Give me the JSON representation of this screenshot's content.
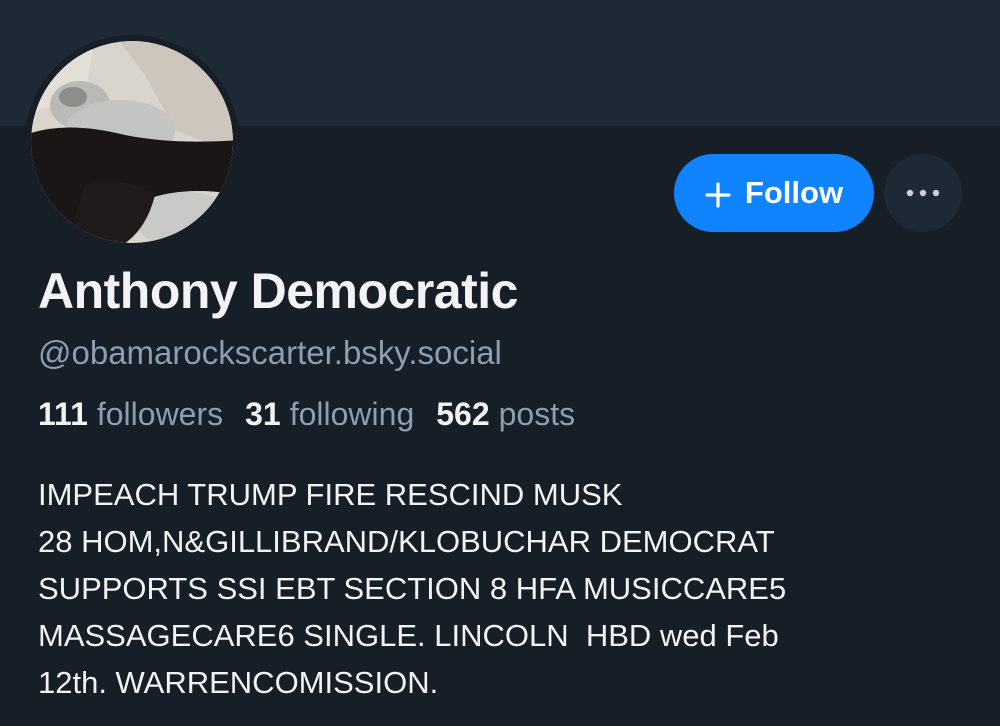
{
  "profile": {
    "display_name": "Anthony Democratic",
    "handle": "@obamarockscarter.bsky.social",
    "follow_label": "Follow",
    "stats": [
      {
        "count": "111",
        "label": "followers"
      },
      {
        "count": "31",
        "label": "following"
      },
      {
        "count": "562",
        "label": "posts"
      }
    ],
    "bio_lines": [
      "IMPEACH TRUMP FIRE RESCIND MUSK",
      "28 HOM,N&GILLIBRAND/KLOBUCHAR DEMOCRAT",
      "SUPPORTS SSI EBT SECTION 8 HFA MUSICCARE5",
      "MASSAGECARE6 SINGLE. LINCOLN  HBD wed Feb",
      "12th. WARRENCOMISSION."
    ]
  },
  "icons": {
    "follow": "plus-icon",
    "more": "more-horizontal-icon"
  },
  "colors": {
    "background": "#161e27",
    "banner": "#1e2936",
    "accent": "#1083fe",
    "text": "#f1f3f5",
    "muted": "#8d9eb1"
  }
}
